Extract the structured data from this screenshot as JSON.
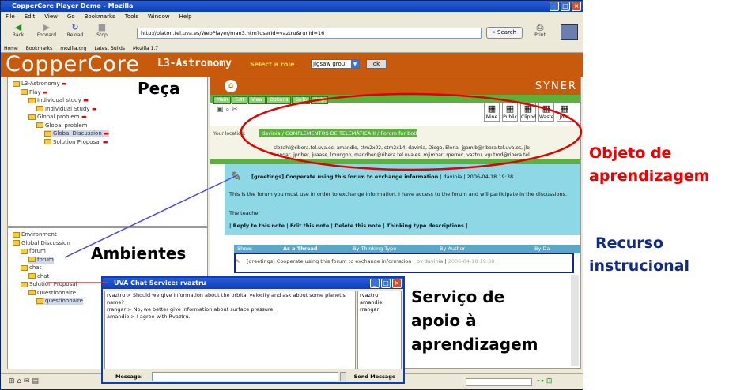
{
  "browser": {
    "title": "CopperCore Player Demo - Mozilla",
    "menu": [
      "File",
      "Edit",
      "View",
      "Go",
      "Bookmarks",
      "Tools",
      "Window",
      "Help"
    ],
    "nav": [
      "Back",
      "Forward",
      "Reload",
      "Stop"
    ],
    "url": "http://platon.tel.uva.es/WebPlayer/man3.htm?userId=vaztru&runId=16",
    "search": "Search",
    "print": "Print",
    "bookmarks": [
      "Home",
      "Bookmarks",
      "mozilla.org",
      "Latest Builds",
      "Mozilla 1.7"
    ]
  },
  "header": {
    "logo": "CopperCore",
    "course": "L3-Astronomy",
    "role_label": "Select a role",
    "role_value": "Jigsaw grou",
    "ok": "ok"
  },
  "tree1": [
    {
      "label": "L3-Astronomy",
      "ind": 0,
      "red": true
    },
    {
      "label": "Play",
      "ind": 1,
      "red": true
    },
    {
      "label": "Individual study",
      "ind": 2,
      "red": true
    },
    {
      "label": "Individual Study",
      "ind": 3,
      "red": true
    },
    {
      "label": "Global problem",
      "ind": 2,
      "red": true
    },
    {
      "label": "Global problem",
      "ind": 3,
      "red": false
    },
    {
      "label": "Global Discussion",
      "ind": 4,
      "red": true,
      "sel": true
    },
    {
      "label": "Solution Proposal",
      "ind": 4,
      "red": true
    }
  ],
  "tree2": [
    {
      "label": "Environment",
      "ind": 0
    },
    {
      "label": "Global Discussion",
      "ind": 0
    },
    {
      "label": "forum",
      "ind": 1
    },
    {
      "label": "forum",
      "ind": 2,
      "sel": true
    },
    {
      "label": "chat",
      "ind": 1
    },
    {
      "label": "chat",
      "ind": 2
    },
    {
      "label": "Solution Proposal",
      "ind": 1
    },
    {
      "label": "Questionnaire",
      "ind": 2
    },
    {
      "label": "questionnaire",
      "ind": 3,
      "sel": true
    }
  ],
  "synergo": {
    "brand": "SYNER",
    "tabs": [
      "Main",
      "Edit",
      "View",
      "Options",
      "GoTo",
      "Help"
    ],
    "icons": [
      "Mine",
      "Public",
      "Clipbd",
      "Waste",
      "Jobs"
    ],
    "location_label": "Your location:",
    "location": "davinia / COMPLEMENTOS DE TELEMÁTICA II / Forum for both teams",
    "members1": "slozahl@ribera.tel.uva.es, amandie, ctm2x02, ctm2x14, davinia, Diego, Elena, jgamib@ribera.tel.uva.es, jlo",
    "members2": "pengar, jpriher, juaase, lmungon, mandhen@ribera.tel.uva.es, mjimbar, rperred, vaztru, vgutrod@ribera.tel.",
    "post_title": "[greetings] Cooperate using this forum to exchange information",
    "post_author": "davinia",
    "post_date": "2006-04-18 19:38",
    "post_body": "This is the forum you must use in order to exchange information. I have access to the forum and will participate in the discussions.",
    "post_sign": "The teacher",
    "post_actions": [
      "Reply to this note",
      "Edit this note",
      "Delete this note",
      "Thinking type descriptions"
    ],
    "table_headers": [
      "Show:",
      "As a Thread",
      "By Thinking Type",
      "By Author",
      "By Da"
    ],
    "row_text": "[greetings] Cooperate using this forum to exchange information",
    "row_author": "by davinia",
    "row_date": "2006-04-18 19:38"
  },
  "chat": {
    "title": "UVA Chat Service: rvaztru",
    "log": [
      "rvaztru > Should we give information about the orbital velocity and ask about some planet's name?",
      "rrangar > No, we better give information about surface pressure.",
      "amandie > I agree with Rvaztru."
    ],
    "users": [
      "rvaztru",
      "amandie",
      "rrangar"
    ],
    "message_label": "Message:",
    "send": "Send Message"
  },
  "annotations": {
    "peca": "Peça",
    "ambientes": "Ambientes",
    "objeto1": "Objeto de",
    "objeto2": "aprendizagem",
    "recurso1": "Recurso",
    "recurso2": "instrucional",
    "servico1": "Serviço de",
    "servico2": "apoio à",
    "servico3": "aprendizagem"
  },
  "colors": {
    "accent": "#c75a0c",
    "red": "#e00000",
    "blue": "#102a8a"
  }
}
